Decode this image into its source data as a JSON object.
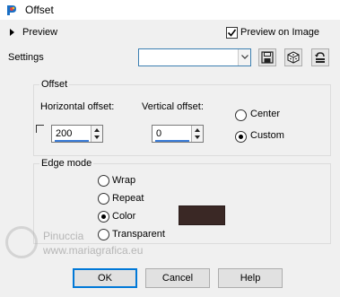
{
  "window": {
    "title": "Offset"
  },
  "preview": {
    "label": "Preview",
    "preview_on_image_label": "Preview on Image",
    "preview_on_image_checked": true
  },
  "settings": {
    "label": "Settings",
    "value": ""
  },
  "offset_group": {
    "title": "Offset",
    "horizontal_label": "Horizontal offset:",
    "horizontal_value": "200",
    "vertical_label": "Vertical offset:",
    "vertical_value": "0",
    "link_checked": false,
    "center_label": "Center",
    "custom_label": "Custom",
    "selected": "Custom"
  },
  "edge_group": {
    "title": "Edge mode",
    "options": [
      "Wrap",
      "Repeat",
      "Color",
      "Transparent"
    ],
    "selected": "Color",
    "color": "#3a2825"
  },
  "buttons": {
    "ok": "OK",
    "cancel": "Cancel",
    "help": "Help"
  },
  "watermark": {
    "line1": "Pinuccia",
    "line2": "www.mariagrafica.eu"
  },
  "colors": {
    "background": "#f0f0f0",
    "accent": "#0078d7"
  }
}
